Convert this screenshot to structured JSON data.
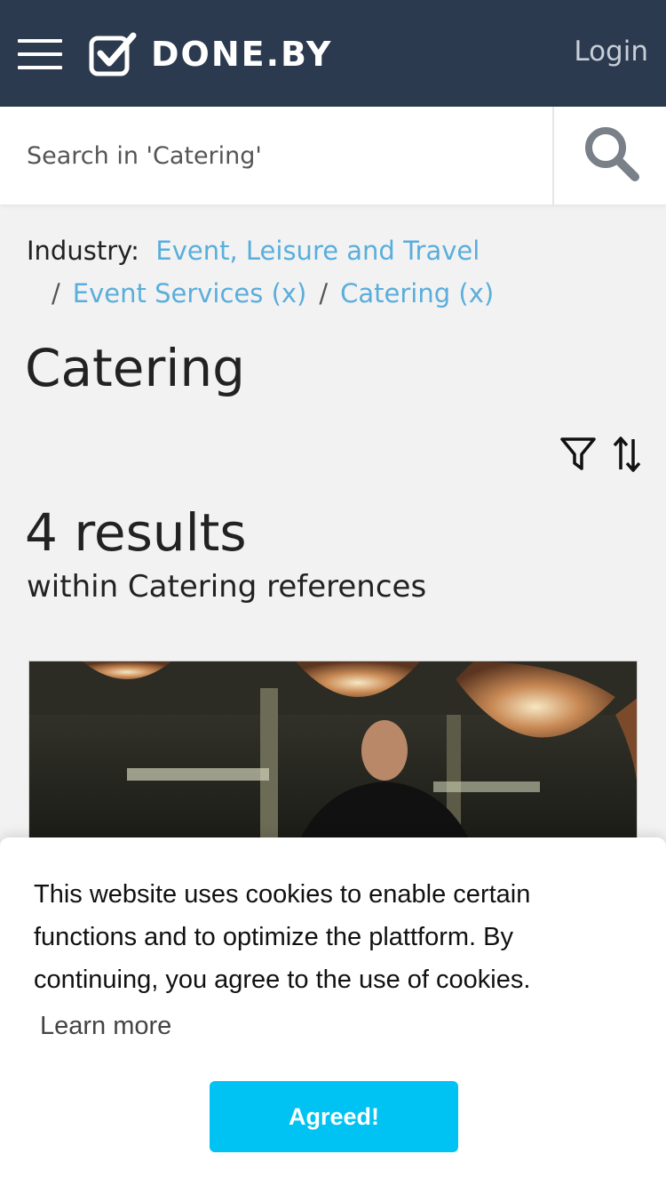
{
  "header": {
    "brand": "DONE.BY",
    "login_label": "Login"
  },
  "search": {
    "placeholder": "Search in 'Catering'"
  },
  "breadcrumb": {
    "label": "Industry:",
    "items": [
      "Event, Leisure and Travel",
      "Event Services (x)",
      "Catering (x)"
    ],
    "separator": "/"
  },
  "page": {
    "title": "Catering",
    "results_count": "4 results",
    "results_sub": "within Catering references"
  },
  "cookie": {
    "message": "This website uses cookies to enable certain functions and to optimize the plattform. By continuing, you agree to the use of cookies.",
    "learn_more": "Learn more",
    "agree_label": "Agreed!"
  },
  "colors": {
    "header_bg": "#2b3a4e",
    "link": "#5aaedc",
    "accent_button": "#00c3f3",
    "page_bg": "#f2f2f2"
  },
  "icons": [
    "hamburger-icon",
    "check-logo-icon",
    "search-icon",
    "filter-icon",
    "sort-icon"
  ]
}
